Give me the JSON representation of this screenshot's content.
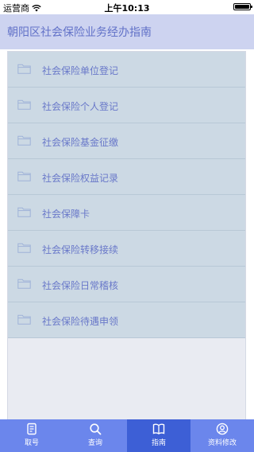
{
  "status_bar": {
    "carrier": "运营商",
    "time": "上午10:13",
    "battery_level": 1.0
  },
  "header": {
    "title": "朝阳区社会保险业务经办指南"
  },
  "menu": {
    "items": [
      {
        "label": "社会保险单位登记",
        "icon": "folder-icon"
      },
      {
        "label": "社会保险个人登记",
        "icon": "folder-icon"
      },
      {
        "label": "社会保险基金征缴",
        "icon": "folder-icon"
      },
      {
        "label": "社会保险权益记录",
        "icon": "folder-icon"
      },
      {
        "label": "社会保障卡",
        "icon": "folder-icon"
      },
      {
        "label": "社会保险转移接续",
        "icon": "folder-icon"
      },
      {
        "label": "社会保险日常稽核",
        "icon": "folder-icon"
      },
      {
        "label": "社会保险待遇申领",
        "icon": "folder-icon"
      }
    ]
  },
  "tab_bar": {
    "tabs": [
      {
        "label": "取号",
        "icon": "ticket-icon",
        "active": false
      },
      {
        "label": "查询",
        "icon": "search-icon",
        "active": false
      },
      {
        "label": "指南",
        "icon": "book-icon",
        "active": true
      },
      {
        "label": "资料修改",
        "icon": "user-icon",
        "active": false
      }
    ]
  },
  "colors": {
    "header_bg": "#cdd3f0",
    "title_text": "#6272c8",
    "item_bg": "#ccd9e4",
    "item_text": "#6978c9",
    "tab_bar_bg": "#6b86ec",
    "tab_active_bg": "#3d5fd6"
  }
}
